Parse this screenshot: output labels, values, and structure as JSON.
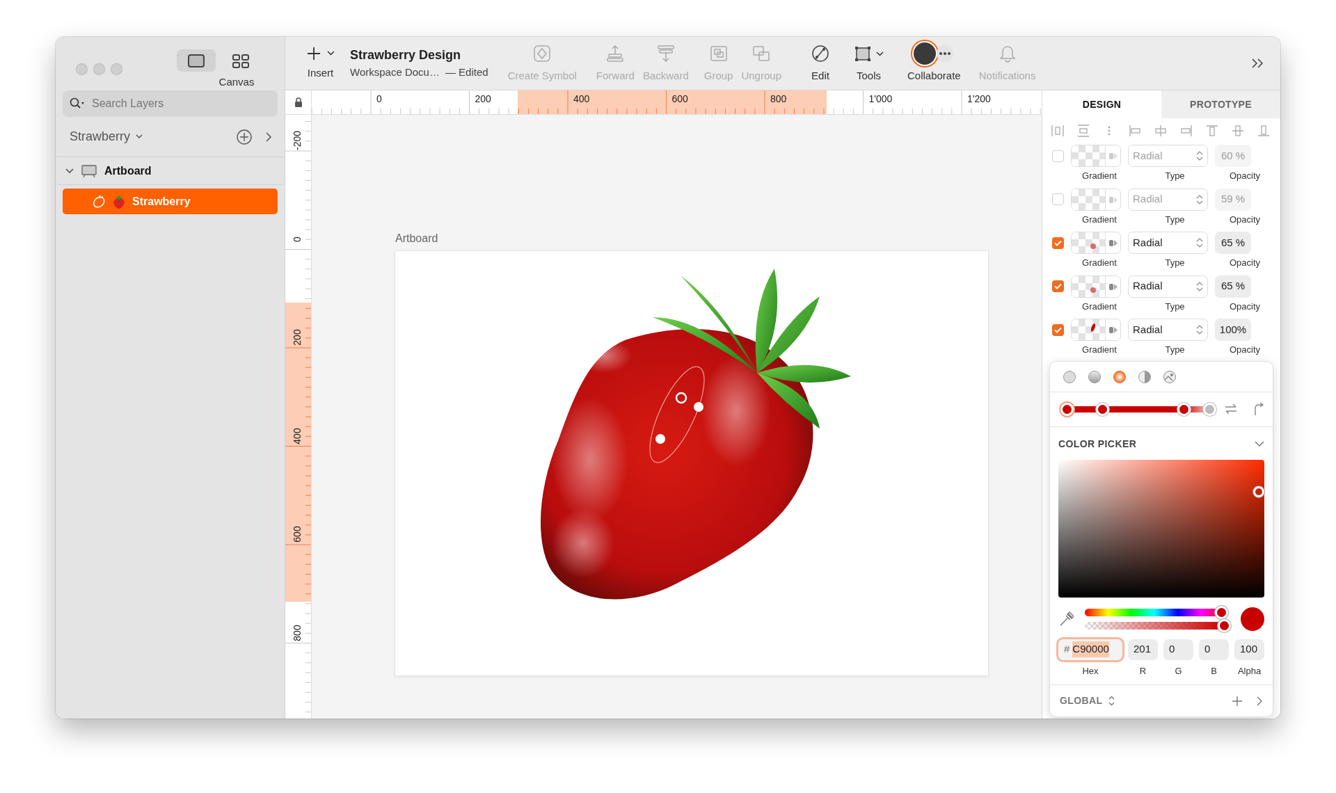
{
  "sidebar": {
    "view_toggle": [
      {
        "kind": "canvas",
        "selected": true
      },
      {
        "kind": "grid",
        "selected": false
      }
    ],
    "view_label": "Canvas",
    "search": {
      "placeholder": "Search Layers"
    },
    "page": "Strawberry",
    "layers": [
      {
        "name": "Artboard",
        "kind": "artboard",
        "expanded": true,
        "selected": false,
        "children": [
          {
            "name": "Strawberry",
            "kind": "shape",
            "selected": true
          }
        ]
      }
    ]
  },
  "toolbar": {
    "insert": "Insert",
    "title": "Strawberry Design",
    "subtitle": "Workspace Docu…",
    "status": "— Edited",
    "buttons": [
      {
        "kind": "symbol",
        "label": "Create Symbol",
        "disabled": true
      },
      {
        "kind": "forward",
        "label": "Forward",
        "disabled": true
      },
      {
        "kind": "backward",
        "label": "Backward",
        "disabled": true
      },
      {
        "kind": "group",
        "label": "Group",
        "disabled": true
      },
      {
        "kind": "ungroup",
        "label": "Ungroup",
        "disabled": true
      },
      {
        "kind": "edit",
        "label": "Edit",
        "disabled": false
      },
      {
        "kind": "tools",
        "label": "Tools",
        "disabled": false
      },
      {
        "kind": "collaborate",
        "label": "Collaborate",
        "disabled": false
      },
      {
        "kind": "notifications",
        "label": "Notifications",
        "disabled": true
      }
    ]
  },
  "rulers": {
    "horizontal": [
      "0",
      "200",
      "400",
      "600",
      "800",
      "1'000",
      "1'200"
    ],
    "vertical": [
      "-200",
      "0",
      "200",
      "400",
      "600",
      "800"
    ]
  },
  "canvas": {
    "artboard": "Artboard"
  },
  "inspector": {
    "tabs": [
      {
        "label": "DESIGN",
        "selected": true
      },
      {
        "label": "PROTOTYPE",
        "selected": false
      }
    ],
    "fills": [
      {
        "enabled": false,
        "kind": "none",
        "type": "Radial",
        "opacity": "60 %",
        "labels": [
          "Gradient",
          "Type",
          "Opacity"
        ]
      },
      {
        "enabled": false,
        "kind": "none",
        "type": "Radial",
        "opacity": "59 %",
        "labels": [
          "Gradient",
          "Type",
          "Opacity"
        ]
      },
      {
        "enabled": true,
        "kind": "dot",
        "type": "Radial",
        "opacity": "65 %",
        "labels": [
          "Gradient",
          "Type",
          "Opacity"
        ]
      },
      {
        "enabled": true,
        "kind": "dot",
        "type": "Radial",
        "opacity": "65 %",
        "labels": [
          "Gradient",
          "Type",
          "Opacity"
        ]
      },
      {
        "enabled": true,
        "kind": "ellipse",
        "type": "Radial",
        "opacity": "100%",
        "labels": [
          "Gradient",
          "Type",
          "Opacity"
        ]
      }
    ],
    "fill_types": [
      {
        "kind": "solid",
        "selected": false
      },
      {
        "kind": "linear",
        "selected": false
      },
      {
        "kind": "radial",
        "selected": true
      },
      {
        "kind": "angular",
        "selected": false
      },
      {
        "kind": "image",
        "selected": false
      }
    ],
    "stops": [
      {
        "level": 0,
        "selected": true
      },
      {
        "level": 0.25,
        "selected": false
      },
      {
        "level": 0.82,
        "selected": false
      },
      {
        "level": 1,
        "selected": false
      }
    ],
    "picker": {
      "title": "COLOR PICKER",
      "hue": {
        "level": 0.98
      },
      "alpha": {
        "level": 1
      },
      "fields": [
        {
          "label": "Hex",
          "prefix": "#",
          "value": "C90000",
          "focused": true
        },
        {
          "label": "R",
          "value": "201",
          "focused": false
        },
        {
          "label": "G",
          "value": "0",
          "focused": false
        },
        {
          "label": "B",
          "value": "0",
          "focused": false
        },
        {
          "label": "Alpha",
          "value": "100",
          "focused": false
        }
      ]
    },
    "global": "GLOBAL"
  }
}
